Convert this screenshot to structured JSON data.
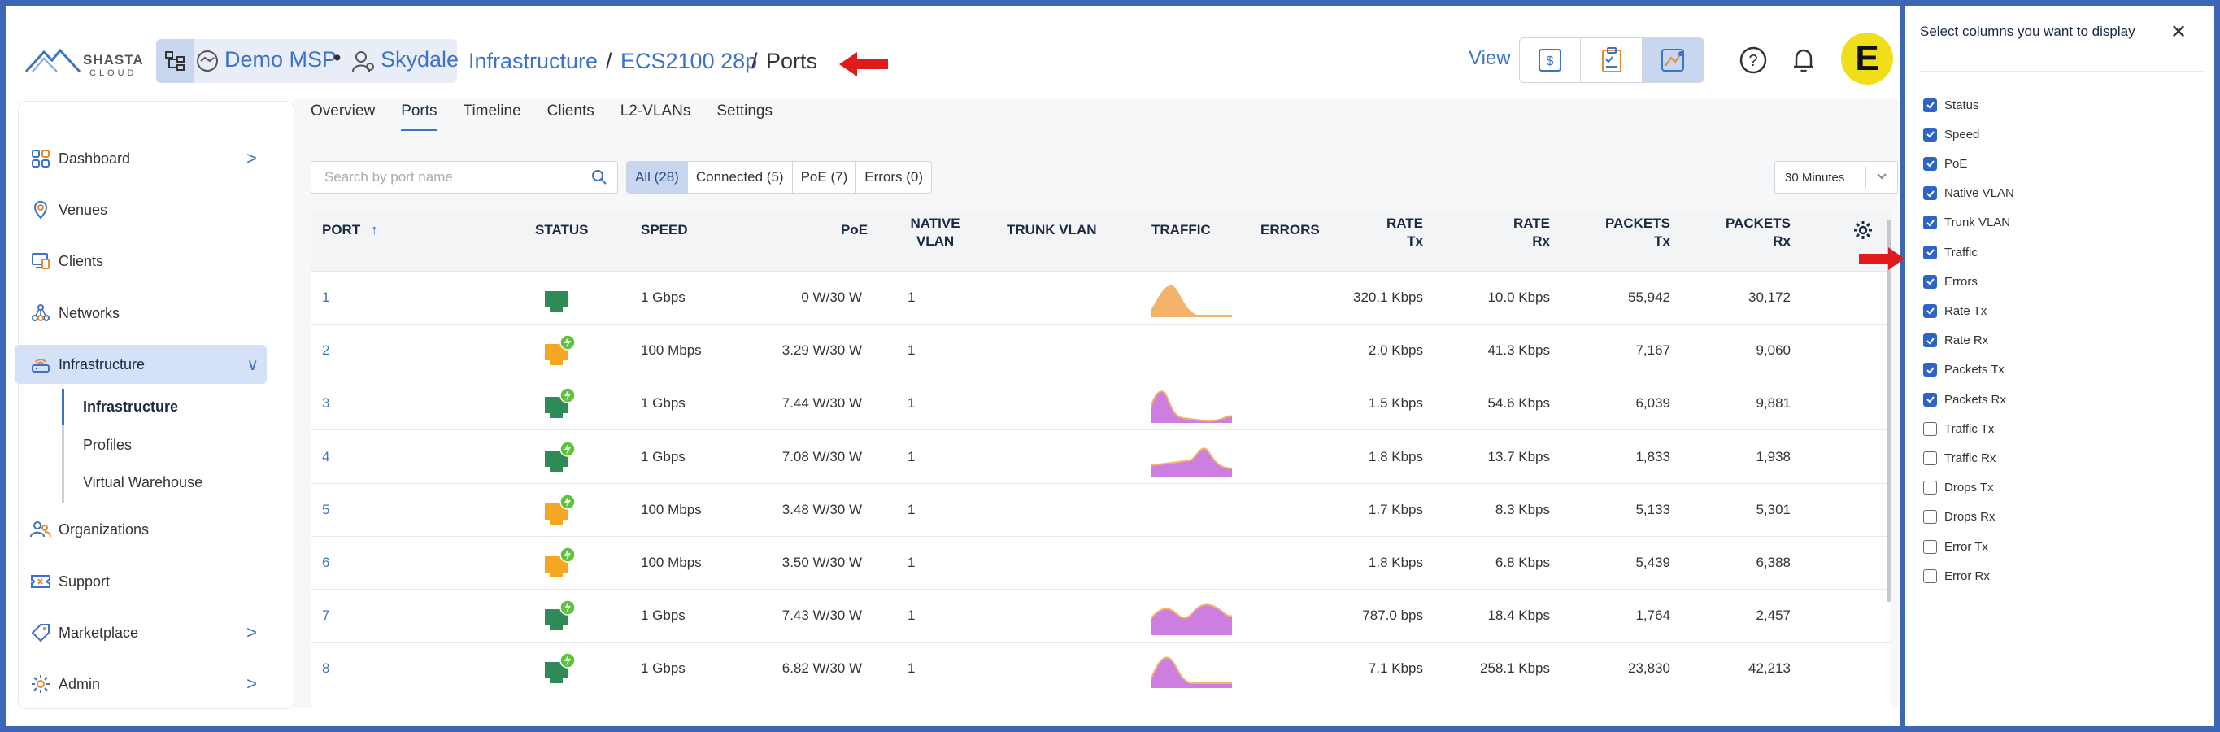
{
  "header": {
    "logo_text": "SHASTA",
    "logo_sub": "CLOUD",
    "org_name": "Demo MSP",
    "customer_name": "Skydale",
    "path_root": "Infrastructure",
    "path_device": "ECS2100 28p",
    "path_page": "Ports",
    "path_sep": "/",
    "view_label": "View",
    "avatar_letter": "E"
  },
  "sidebar": {
    "items": [
      {
        "label": "Dashboard",
        "icon": "dashboard-icon",
        "chevron": ">"
      },
      {
        "label": "Venues",
        "icon": "location-pin-icon"
      },
      {
        "label": "Clients",
        "icon": "monitor-icon"
      },
      {
        "label": "Networks",
        "icon": "network-icon"
      },
      {
        "label": "Infrastructure",
        "icon": "router-icon",
        "chevron": "∨"
      },
      {
        "label": "Organizations",
        "icon": "people-icon"
      },
      {
        "label": "Support",
        "icon": "ticket-icon"
      },
      {
        "label": "Marketplace",
        "icon": "tag-icon",
        "chevron": ">"
      },
      {
        "label": "Admin",
        "icon": "gear-icon",
        "chevron": ">"
      }
    ],
    "sub_items": [
      "Infrastructure",
      "Profiles",
      "Virtual Warehouse"
    ]
  },
  "tabs": [
    "Overview",
    "Ports",
    "Timeline",
    "Clients",
    "L2-VLANs",
    "Settings"
  ],
  "active_tab": "Ports",
  "search": {
    "placeholder": "Search by port name"
  },
  "filters": [
    "All (28)",
    "Connected (5)",
    "PoE (7)",
    "Errors (0)"
  ],
  "time_range": "30 Minutes",
  "table": {
    "headers": {
      "port": "PORT",
      "sort_arrow": "↑",
      "status": "STATUS",
      "speed": "SPEED",
      "poe": "PoE",
      "native_vlan_1": "NATIVE",
      "native_vlan_2": "VLAN",
      "trunk_vlan": "TRUNK VLAN",
      "traffic": "TRAFFIC",
      "errors": "ERRORS",
      "rate_tx_1": "RATE",
      "rate_tx_2": "Tx",
      "rate_rx_1": "RATE",
      "rate_rx_2": "Rx",
      "packets_tx_1": "PACKETS",
      "packets_tx_2": "Tx",
      "packets_rx_1": "PACKETS",
      "packets_rx_2": "Rx"
    },
    "rows": [
      {
        "port": "1",
        "status": "connected",
        "poe_active": false,
        "speed": "1 Gbps",
        "poe": "0 W/30 W",
        "native_vlan": "1",
        "traffic": "orange-peak",
        "rate_tx": "320.1 Kbps",
        "rate_rx": "10.0 Kbps",
        "packets_tx": "55,942",
        "packets_rx": "30,172"
      },
      {
        "port": "2",
        "status": "warning",
        "poe_active": true,
        "speed": "100 Mbps",
        "poe": "3.29 W/30 W",
        "native_vlan": "1",
        "traffic": "none",
        "rate_tx": "2.0 Kbps",
        "rate_rx": "41.3 Kbps",
        "packets_tx": "7,167",
        "packets_rx": "9,060"
      },
      {
        "port": "3",
        "status": "connected",
        "poe_active": true,
        "speed": "1 Gbps",
        "poe": "7.44 W/30 W",
        "native_vlan": "1",
        "traffic": "purple-early",
        "rate_tx": "1.5 Kbps",
        "rate_rx": "54.6 Kbps",
        "packets_tx": "6,039",
        "packets_rx": "9,881"
      },
      {
        "port": "4",
        "status": "connected",
        "poe_active": true,
        "speed": "1 Gbps",
        "poe": "7.08 W/30 W",
        "native_vlan": "1",
        "traffic": "purple-mid",
        "rate_tx": "1.8 Kbps",
        "rate_rx": "13.7 Kbps",
        "packets_tx": "1,833",
        "packets_rx": "1,938"
      },
      {
        "port": "5",
        "status": "warning",
        "poe_active": true,
        "speed": "100 Mbps",
        "poe": "3.48 W/30 W",
        "native_vlan": "1",
        "traffic": "none",
        "rate_tx": "1.7 Kbps",
        "rate_rx": "8.3 Kbps",
        "packets_tx": "5,133",
        "packets_rx": "5,301"
      },
      {
        "port": "6",
        "status": "warning",
        "poe_active": true,
        "speed": "100 Mbps",
        "poe": "3.50 W/30 W",
        "native_vlan": "1",
        "traffic": "none",
        "rate_tx": "1.8 Kbps",
        "rate_rx": "6.8 Kbps",
        "packets_tx": "5,439",
        "packets_rx": "6,388"
      },
      {
        "port": "7",
        "status": "connected",
        "poe_active": true,
        "speed": "1 Gbps",
        "poe": "7.43 W/30 W",
        "native_vlan": "1",
        "traffic": "purple-double",
        "rate_tx": "787.0 bps",
        "rate_rx": "18.4 Kbps",
        "packets_tx": "1,764",
        "packets_rx": "2,457"
      },
      {
        "port": "8",
        "status": "connected",
        "poe_active": true,
        "speed": "1 Gbps",
        "poe": "6.82 W/30 W",
        "native_vlan": "1",
        "traffic": "purple-peak",
        "rate_tx": "7.1 Kbps",
        "rate_rx": "258.1 Kbps",
        "packets_tx": "23,830",
        "packets_rx": "42,213"
      }
    ]
  },
  "column_panel": {
    "title": "Select columns you want to display",
    "close": "✕",
    "options": [
      {
        "label": "Status",
        "checked": true
      },
      {
        "label": "Speed",
        "checked": true
      },
      {
        "label": "PoE",
        "checked": true
      },
      {
        "label": "Native VLAN",
        "checked": true
      },
      {
        "label": "Trunk VLAN",
        "checked": true
      },
      {
        "label": "Traffic",
        "checked": true
      },
      {
        "label": "Errors",
        "checked": true
      },
      {
        "label": "Rate Tx",
        "checked": true
      },
      {
        "label": "Rate Rx",
        "checked": true
      },
      {
        "label": "Packets Tx",
        "checked": true
      },
      {
        "label": "Packets Rx",
        "checked": true
      },
      {
        "label": "Traffic Tx",
        "checked": false
      },
      {
        "label": "Traffic Rx",
        "checked": false
      },
      {
        "label": "Drops Tx",
        "checked": false
      },
      {
        "label": "Drops Rx",
        "checked": false
      },
      {
        "label": "Error Tx",
        "checked": false
      },
      {
        "label": "Error Rx",
        "checked": false
      }
    ]
  },
  "colors": {
    "accent": "#3d72c4",
    "frame": "#3d66b4",
    "status_connected": "#2e8b57",
    "status_warning": "#f5a623",
    "poe_badge": "#5cc33a",
    "traffic_orange": "#f4b36a",
    "traffic_purple": "#cd7fe0",
    "annotation_arrow": "#e01b1b"
  }
}
